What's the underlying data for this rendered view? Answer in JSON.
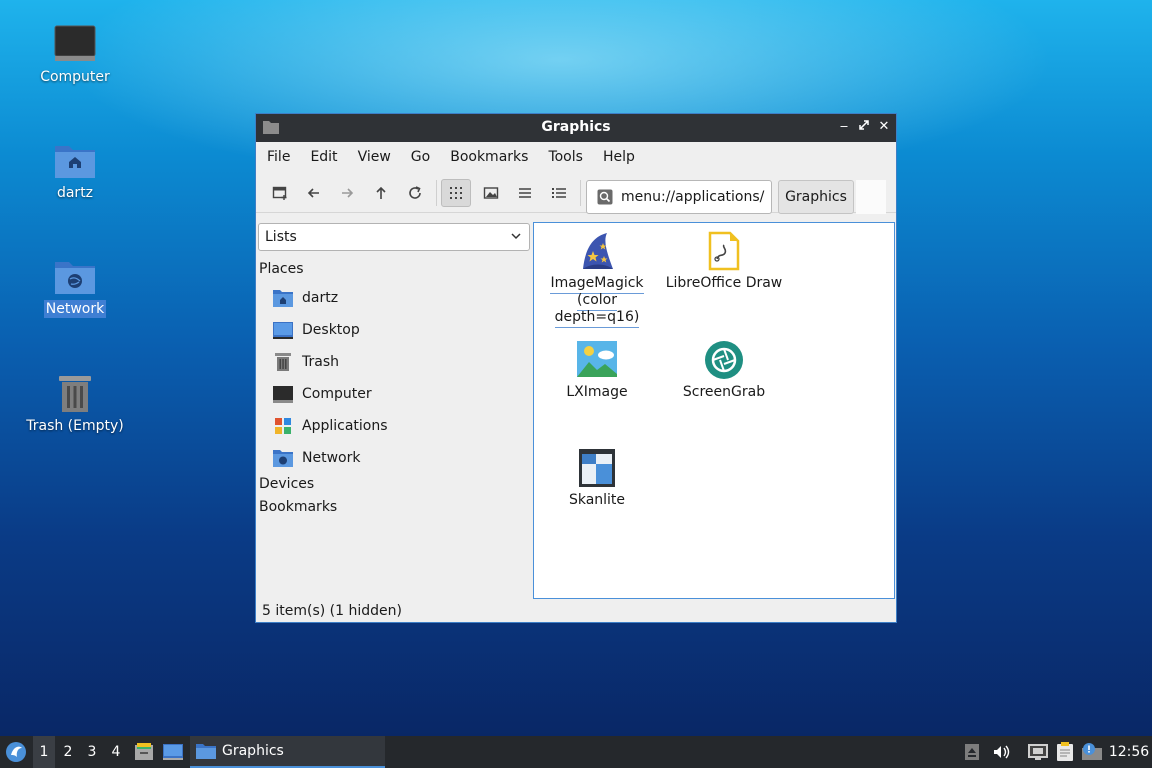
{
  "desktop": {
    "icons": [
      {
        "label": "Computer"
      },
      {
        "label": "dartz"
      },
      {
        "label": "Network"
      },
      {
        "label": "Trash (Empty)"
      }
    ]
  },
  "window": {
    "title": "Graphics",
    "menu": [
      "File",
      "Edit",
      "View",
      "Go",
      "Bookmarks",
      "Tools",
      "Help"
    ],
    "path": "menu://applications/",
    "breadcrumb": "Graphics",
    "side_pane": {
      "mode": "Lists",
      "places_header": "Places",
      "places": [
        "dartz",
        "Desktop",
        "Trash",
        "Computer",
        "Applications",
        "Network"
      ],
      "devices_header": "Devices",
      "bookmarks_header": "Bookmarks"
    },
    "files": [
      {
        "name": "ImageMagick (color depth=q16)"
      },
      {
        "name": "LibreOffice Draw"
      },
      {
        "name": "LXImage"
      },
      {
        "name": "ScreenGrab"
      },
      {
        "name": "Skanlite"
      }
    ],
    "status": "5 item(s) (1 hidden)"
  },
  "taskbar": {
    "workspaces": [
      "1",
      "2",
      "3",
      "4"
    ],
    "active_task": "Graphics",
    "clock": "12:56"
  },
  "colors": {
    "accent": "#4a90d9",
    "titlebar": "#2f3236",
    "taskbar": "#25282c"
  }
}
